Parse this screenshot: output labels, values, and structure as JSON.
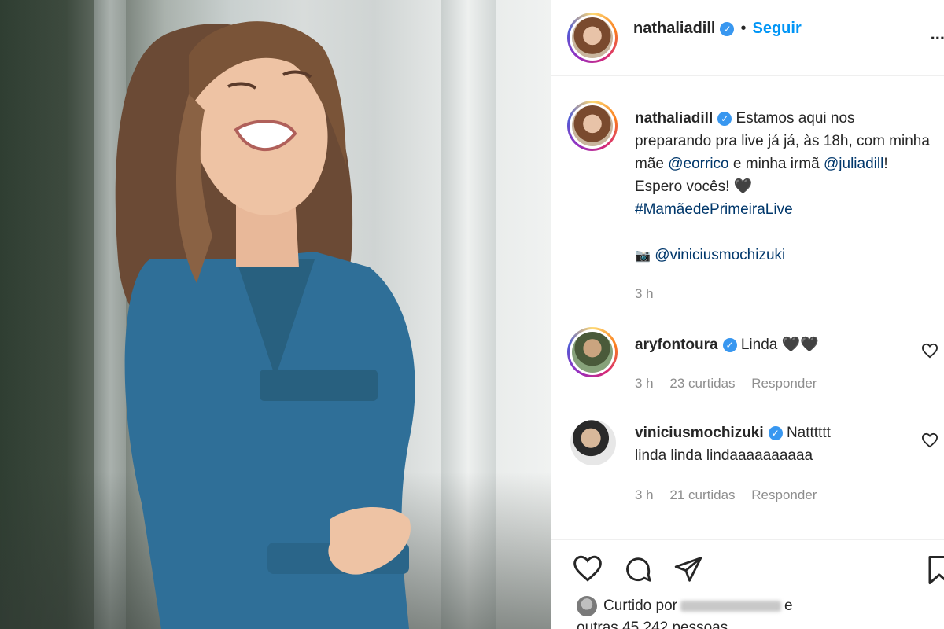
{
  "post": {
    "author": "nathaliadill",
    "follow_label": "Seguir",
    "separator": "•",
    "more_label": "...",
    "caption": {
      "text_1": "Estamos aqui nos preparando pra live já já, às 18h, com minha mãe ",
      "mention_1": "@eorrico",
      "text_2": " e minha irmã ",
      "mention_2": "@juliadill",
      "text_3": "! Espero vocês! 🖤",
      "hashtag": "#MamãedePrimeiraLive",
      "credit_icon": "📷",
      "credit_mention": "@viniciusmochizuki",
      "time": "3 h"
    },
    "verified_glyph": "✓"
  },
  "comments": [
    {
      "user": "aryfontoura",
      "text": "Linda 🖤🖤",
      "time": "3 h",
      "likes": "23 curtidas",
      "reply": "Responder"
    },
    {
      "user": "viniciusmochizuki",
      "text_line1": "Natttttt",
      "text_line2": "linda linda lindaaaaaaaaaa",
      "time": "3 h",
      "likes": "21 curtidas",
      "reply": "Responder"
    }
  ],
  "likes": {
    "prefix": "Curtido por",
    "suffix": "e",
    "line2": "outras 45.242 pessoas"
  },
  "icons": {
    "like": "heart-icon",
    "comment": "comment-icon",
    "share": "share-icon",
    "save": "bookmark-icon",
    "comment_like": "heart-outline-icon"
  },
  "colors": {
    "link": "#0095f6",
    "mention": "#00376b",
    "verified": "#3897f0",
    "muted": "#8e8e8e"
  }
}
